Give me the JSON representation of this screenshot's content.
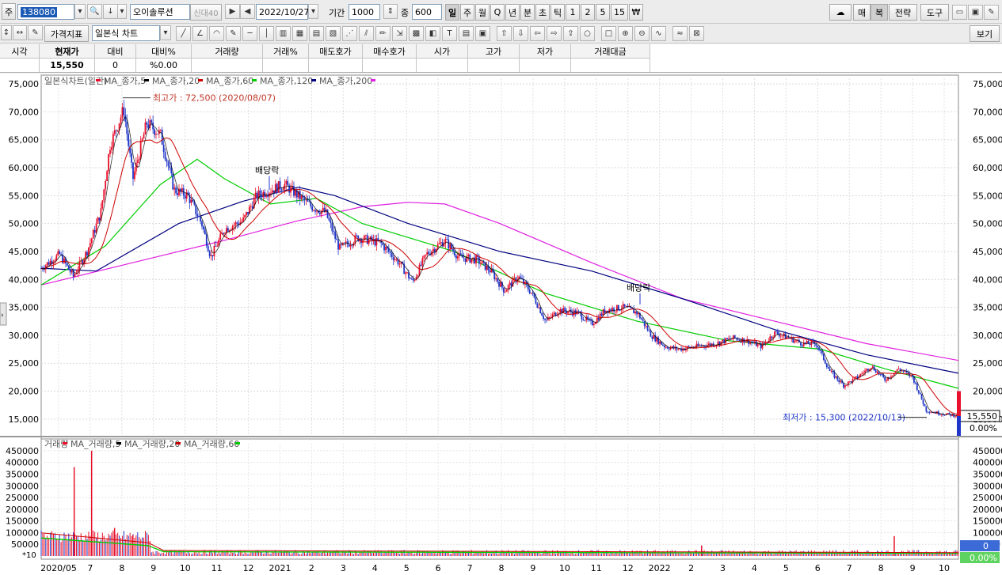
{
  "toolbar": {
    "market_label": "주",
    "code": "138080",
    "name": "오이솔루션",
    "credit_label": "신대40",
    "date": "2022/10/27",
    "period_label": "기간",
    "period_value": "1000",
    "count_label": "종",
    "count_value": "600",
    "timeframes": [
      "일",
      "주",
      "월",
      "Q",
      "년",
      "분",
      "초",
      "틱",
      "1",
      "2",
      "5",
      "15",
      "₩"
    ],
    "right_buttons": [
      "매",
      "복",
      "전략",
      "도구"
    ],
    "indicator_label": "가격지표",
    "chart_type": "일본식 차트",
    "view_label": "보기"
  },
  "quote": {
    "headers": [
      "시각",
      "현재가",
      "대비",
      "대비%",
      "거래량",
      "거래%",
      "매도호가",
      "매수호가",
      "시가",
      "고가",
      "저가",
      "거래대금"
    ],
    "values": [
      "",
      "15,550",
      "0",
      "%0.00",
      "",
      "",
      "",
      "",
      "",
      "",
      "",
      ""
    ]
  },
  "legend_price": [
    {
      "name": "일본식차트(일간)",
      "color": "#e8102c"
    },
    {
      "name": "MA_종가,5",
      "color": "#000000"
    },
    {
      "name": "MA_종가,20",
      "color": "#cc0000"
    },
    {
      "name": "MA_종가,60",
      "color": "#00cc00"
    },
    {
      "name": "MA_종가,120",
      "color": "#000080"
    },
    {
      "name": "MA_종가,200",
      "color": "#e020e0"
    }
  ],
  "legend_volume": [
    {
      "name": "거래량",
      "color": "#e8102c"
    },
    {
      "name": "MA_거래량,5",
      "color": "#000000"
    },
    {
      "name": "MA_거래량,20",
      "color": "#cc0000"
    },
    {
      "name": "MA_거래량,60",
      "color": "#00cc00"
    }
  ],
  "annotations": {
    "high": "최고가 : 72,500 (2020/08/07)",
    "low": "최저가 : 15,300 (2022/10/13)",
    "dividend": "배당락",
    "current_price": "15,550",
    "change_pct": "0.00%",
    "vol_current": "0",
    "vol_pct": "0.00%",
    "vol_scale": "*10"
  },
  "chart_data": {
    "type": "candlestick",
    "yaxis_price": [
      15000,
      20000,
      25000,
      30000,
      35000,
      40000,
      45000,
      50000,
      55000,
      60000,
      65000,
      70000,
      75000
    ],
    "yaxis_volume": [
      50000,
      100000,
      150000,
      200000,
      250000,
      300000,
      350000,
      400000,
      450000
    ],
    "x_ticks": [
      "2020/05",
      "7",
      "8",
      "9",
      "10",
      "11",
      "12",
      "2021",
      "2",
      "3",
      "4",
      "5",
      "6",
      "7",
      "8",
      "9",
      "10",
      "11",
      "12",
      "2022",
      "2",
      "3",
      "4",
      "5",
      "6",
      "7",
      "8",
      "9",
      "10"
    ],
    "ylim_price": [
      12000,
      76000
    ],
    "ylim_volume": [
      0,
      480000
    ],
    "price_series": [
      {
        "t": 0,
        "v": 42000
      },
      {
        "t": 0.02,
        "v": 44500
      },
      {
        "t": 0.035,
        "v": 40500
      },
      {
        "t": 0.05,
        "v": 45000
      },
      {
        "t": 0.065,
        "v": 52000
      },
      {
        "t": 0.075,
        "v": 64000
      },
      {
        "t": 0.09,
        "v": 70500
      },
      {
        "t": 0.1,
        "v": 58000
      },
      {
        "t": 0.115,
        "v": 68000
      },
      {
        "t": 0.13,
        "v": 66000
      },
      {
        "t": 0.145,
        "v": 56000
      },
      {
        "t": 0.16,
        "v": 55000
      },
      {
        "t": 0.175,
        "v": 50000
      },
      {
        "t": 0.185,
        "v": 44000
      },
      {
        "t": 0.2,
        "v": 49000
      },
      {
        "t": 0.22,
        "v": 50500
      },
      {
        "t": 0.235,
        "v": 55000
      },
      {
        "t": 0.25,
        "v": 56000
      },
      {
        "t": 0.265,
        "v": 57000
      },
      {
        "t": 0.28,
        "v": 55000
      },
      {
        "t": 0.295,
        "v": 53000
      },
      {
        "t": 0.31,
        "v": 52000
      },
      {
        "t": 0.325,
        "v": 45500
      },
      {
        "t": 0.345,
        "v": 47500
      },
      {
        "t": 0.37,
        "v": 46500
      },
      {
        "t": 0.39,
        "v": 43000
      },
      {
        "t": 0.405,
        "v": 39500
      },
      {
        "t": 0.42,
        "v": 44500
      },
      {
        "t": 0.44,
        "v": 47000
      },
      {
        "t": 0.455,
        "v": 44000
      },
      {
        "t": 0.475,
        "v": 43500
      },
      {
        "t": 0.49,
        "v": 41500
      },
      {
        "t": 0.505,
        "v": 38000
      },
      {
        "t": 0.52,
        "v": 40500
      },
      {
        "t": 0.535,
        "v": 37500
      },
      {
        "t": 0.55,
        "v": 32500
      },
      {
        "t": 0.565,
        "v": 34500
      },
      {
        "t": 0.585,
        "v": 34000
      },
      {
        "t": 0.6,
        "v": 32000
      },
      {
        "t": 0.615,
        "v": 34500
      },
      {
        "t": 0.635,
        "v": 35000
      },
      {
        "t": 0.65,
        "v": 34000
      },
      {
        "t": 0.665,
        "v": 30000
      },
      {
        "t": 0.68,
        "v": 28000
      },
      {
        "t": 0.695,
        "v": 27500
      },
      {
        "t": 0.715,
        "v": 28000
      },
      {
        "t": 0.735,
        "v": 28500
      },
      {
        "t": 0.755,
        "v": 29500
      },
      {
        "t": 0.77,
        "v": 29000
      },
      {
        "t": 0.785,
        "v": 28000
      },
      {
        "t": 0.8,
        "v": 30500
      },
      {
        "t": 0.815,
        "v": 29500
      },
      {
        "t": 0.83,
        "v": 28500
      },
      {
        "t": 0.845,
        "v": 28500
      },
      {
        "t": 0.86,
        "v": 23500
      },
      {
        "t": 0.875,
        "v": 21000
      },
      {
        "t": 0.89,
        "v": 22500
      },
      {
        "t": 0.905,
        "v": 24500
      },
      {
        "t": 0.92,
        "v": 22000
      },
      {
        "t": 0.935,
        "v": 24000
      },
      {
        "t": 0.95,
        "v": 22500
      },
      {
        "t": 0.965,
        "v": 16500
      },
      {
        "t": 0.98,
        "v": 16000
      },
      {
        "t": 1,
        "v": 15550
      }
    ],
    "ma200": [
      {
        "t": 0,
        "v": 39000
      },
      {
        "t": 0.1,
        "v": 43000
      },
      {
        "t": 0.2,
        "v": 47000
      },
      {
        "t": 0.28,
        "v": 50500
      },
      {
        "t": 0.35,
        "v": 53000
      },
      {
        "t": 0.4,
        "v": 53800
      },
      {
        "t": 0.44,
        "v": 53500
      },
      {
        "t": 0.5,
        "v": 50000
      },
      {
        "t": 0.6,
        "v": 43000
      },
      {
        "t": 0.7,
        "v": 36500
      },
      {
        "t": 0.8,
        "v": 32500
      },
      {
        "t": 0.9,
        "v": 28500
      },
      {
        "t": 1,
        "v": 25500
      }
    ],
    "ma120": [
      {
        "t": 0,
        "v": 42000
      },
      {
        "t": 0.06,
        "v": 41500
      },
      {
        "t": 0.15,
        "v": 50000
      },
      {
        "t": 0.22,
        "v": 54000
      },
      {
        "t": 0.28,
        "v": 56500
      },
      {
        "t": 0.32,
        "v": 55000
      },
      {
        "t": 0.4,
        "v": 50000
      },
      {
        "t": 0.5,
        "v": 45000
      },
      {
        "t": 0.6,
        "v": 41500
      },
      {
        "t": 0.7,
        "v": 36500
      },
      {
        "t": 0.8,
        "v": 31000
      },
      {
        "t": 0.9,
        "v": 26500
      },
      {
        "t": 1,
        "v": 23200
      }
    ],
    "ma60": [
      {
        "t": 0,
        "v": 39000
      },
      {
        "t": 0.07,
        "v": 46000
      },
      {
        "t": 0.13,
        "v": 57000
      },
      {
        "t": 0.17,
        "v": 61500
      },
      {
        "t": 0.2,
        "v": 58000
      },
      {
        "t": 0.25,
        "v": 53500
      },
      {
        "t": 0.3,
        "v": 54500
      },
      {
        "t": 0.35,
        "v": 50000
      },
      {
        "t": 0.45,
        "v": 45000
      },
      {
        "t": 0.55,
        "v": 37500
      },
      {
        "t": 0.65,
        "v": 32500
      },
      {
        "t": 0.75,
        "v": 29000
      },
      {
        "t": 0.85,
        "v": 27500
      },
      {
        "t": 0.92,
        "v": 24000
      },
      {
        "t": 1,
        "v": 20500
      }
    ],
    "volume_spikes": [
      {
        "t": 0.036,
        "v": 380000
      },
      {
        "t": 0.055,
        "v": 450000
      },
      {
        "t": 0.08,
        "v": 120000
      },
      {
        "t": 0.1,
        "v": 90000
      },
      {
        "t": 0.72,
        "v": 45000
      },
      {
        "t": 0.93,
        "v": 85000
      }
    ]
  }
}
